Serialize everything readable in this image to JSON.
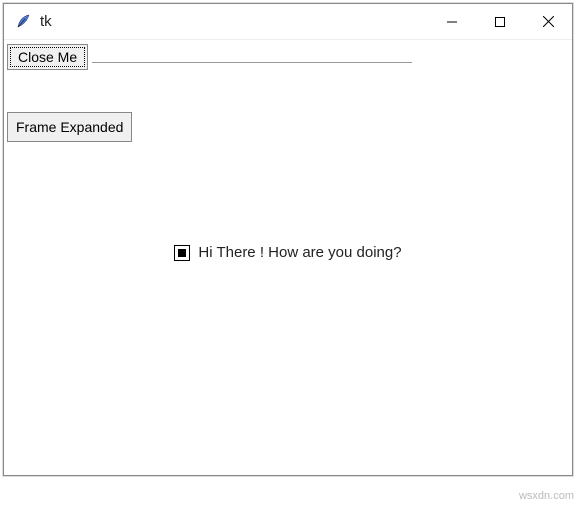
{
  "window": {
    "title": "tk"
  },
  "buttons": {
    "close_me_label": "Close Me",
    "frame_expanded_label": "Frame Expanded"
  },
  "checkbox": {
    "label": "Hi There ! How are you doing?",
    "checked": true
  },
  "watermark": "wsxdn.com"
}
